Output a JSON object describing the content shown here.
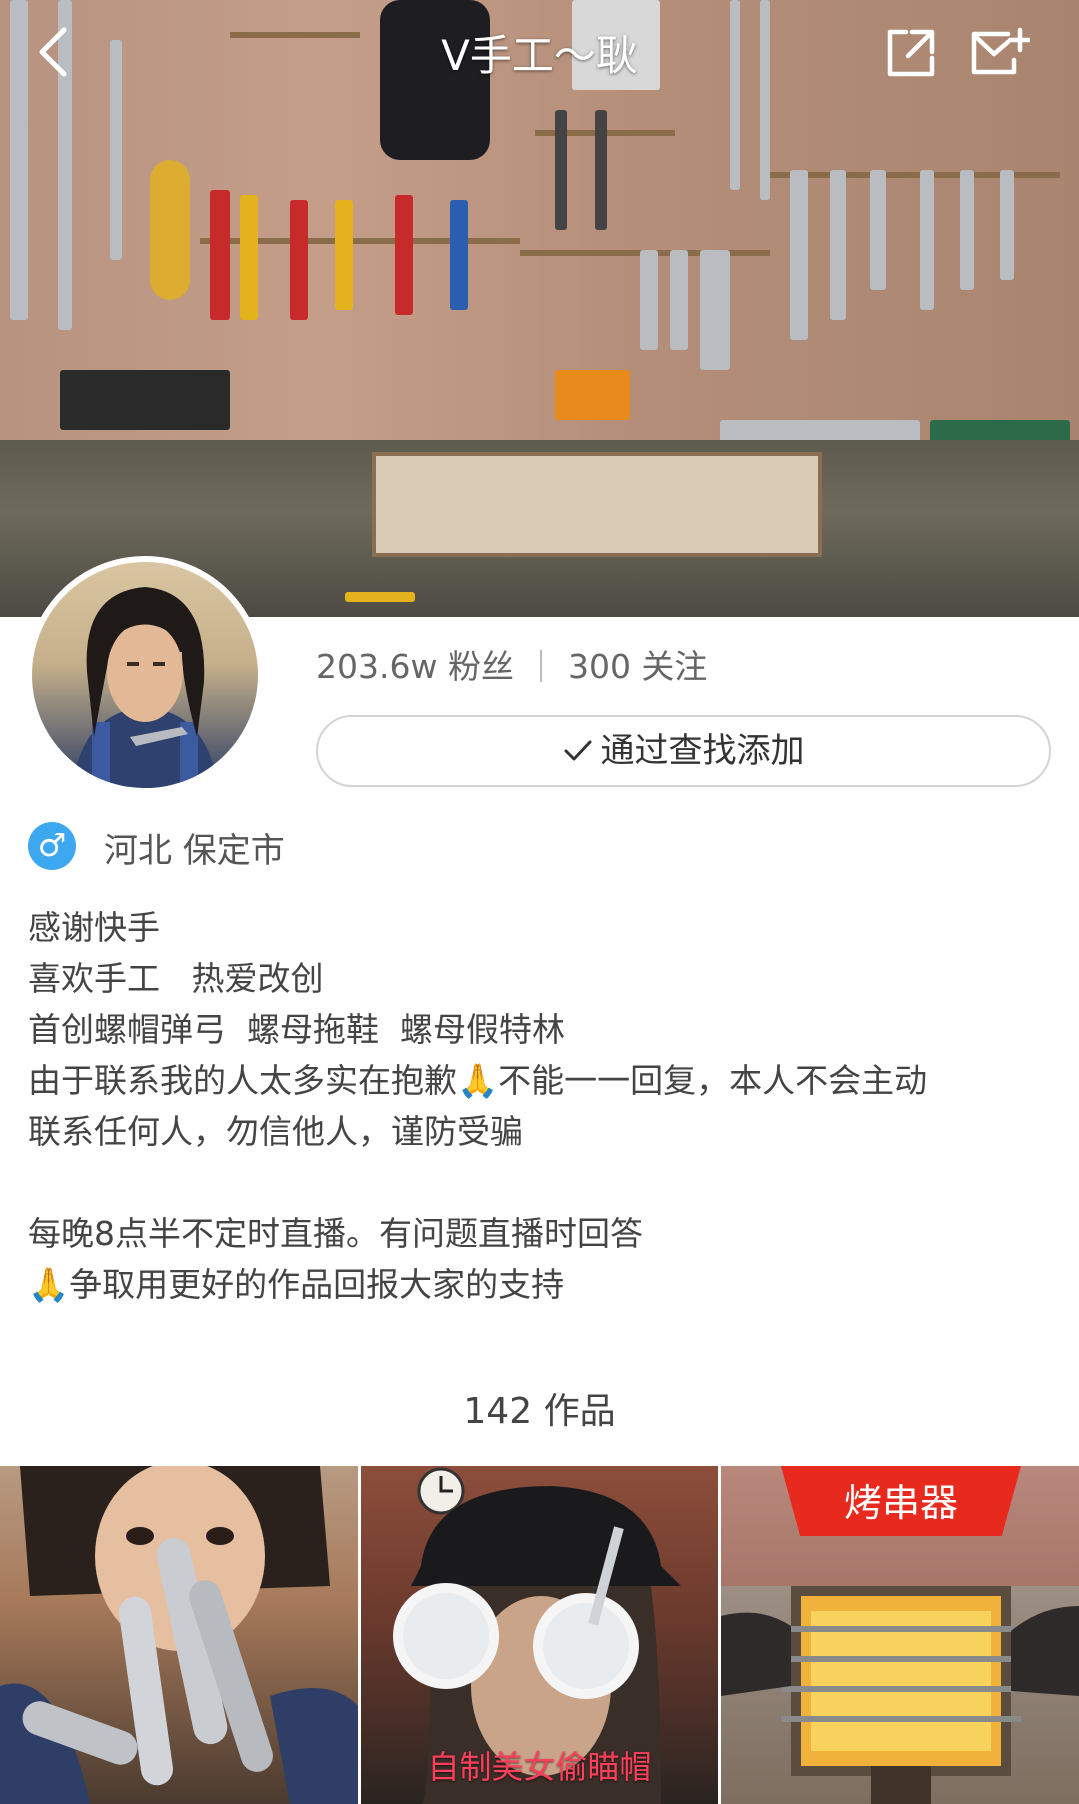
{
  "header": {
    "title": "V手工～耿",
    "icons": [
      "back-icon",
      "share-icon",
      "message-icon"
    ]
  },
  "profile": {
    "followers": "203.6w 粉丝",
    "following": "300 关注",
    "follow_button": "通过查找添加",
    "gender_symbol": "♂",
    "location": "河北 保定市"
  },
  "bio": {
    "lines": [
      "感谢快手",
      "喜欢手工   热爱改创",
      "首创螺帽弹弓  螺母拖鞋  螺母假特林",
      "由于联系我的人太多实在抱歉🙏不能一一回复，本人不会主动",
      "联系任何人，勿信他人，谨防受骗",
      "",
      "每晚8点半不定时直播。有问题直播时回答",
      "🙏争取用更好的作品回报大家的支持"
    ]
  },
  "works": {
    "count_label": "142 作品",
    "items": [
      {
        "caption": ""
      },
      {
        "caption": "自制美女偷瞄帽"
      },
      {
        "banner": "烤串器",
        "caption": ""
      }
    ]
  },
  "colors": {
    "gender_badge": "#3da7f0",
    "caption_red": "#ff3f5b",
    "banner_red": "#e82a1e"
  }
}
